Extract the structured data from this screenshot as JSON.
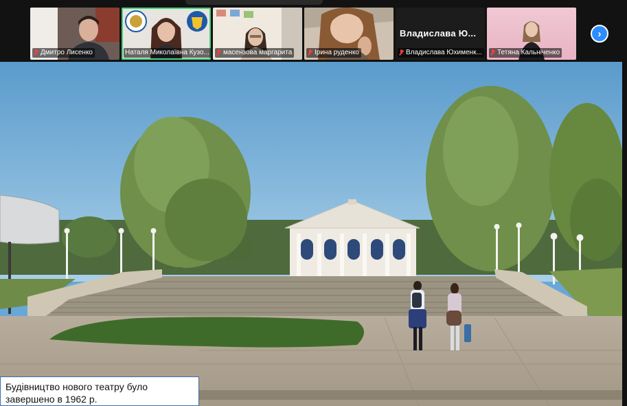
{
  "participants": [
    {
      "name": "Дмитро Лисенко",
      "muted": true,
      "video": "person-male"
    },
    {
      "name": "Наталя Миколаївна Кузо...",
      "muted": false,
      "video": "person-female-logos",
      "active": true
    },
    {
      "name": "масензова маргарита",
      "muted": true,
      "video": "person-female-room"
    },
    {
      "name": "Ірина руденко",
      "muted": true,
      "video": "person-female-close"
    },
    {
      "name": "Владислава Юхименк...",
      "muted": true,
      "video": "no-video",
      "display_name": "Владислава Ю..."
    },
    {
      "name": "Тетяна Кальніченко",
      "muted": true,
      "video": "person-female-pink"
    }
  ],
  "controls": {
    "next_page_icon": "chevron-right-icon"
  },
  "shared_content": {
    "caption": "Будівництво нового театру було завершено в 1962 р.",
    "caption_line1": "Будівництво нового театру було",
    "caption_line2": "завершено в 1962 р."
  },
  "colors": {
    "active_speaker": "#3fd17a",
    "accent": "#2d8cff",
    "muted_mic": "#ff3b3b"
  }
}
